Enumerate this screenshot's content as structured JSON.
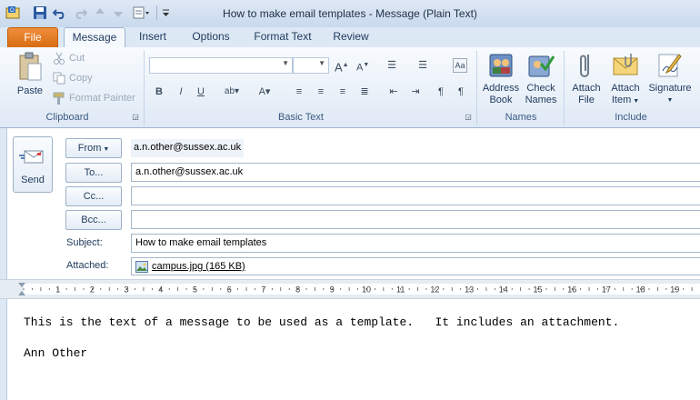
{
  "window": {
    "title": "How to make email templates  -  Message (Plain Text)"
  },
  "tabs": [
    {
      "label": "File"
    },
    {
      "label": "Message"
    },
    {
      "label": "Insert"
    },
    {
      "label": "Options"
    },
    {
      "label": "Format Text"
    },
    {
      "label": "Review"
    }
  ],
  "ribbon": {
    "clipboard": {
      "label": "Clipboard",
      "paste": "Paste",
      "cut": "Cut",
      "copy": "Copy",
      "format_painter": "Format Painter"
    },
    "basic_text": {
      "label": "Basic Text"
    },
    "names": {
      "label": "Names",
      "address_book_1": "Address",
      "address_book_2": "Book",
      "check_names_1": "Check",
      "check_names_2": "Names"
    },
    "include": {
      "label": "Include",
      "attach_file_1": "Attach",
      "attach_file_2": "File",
      "attach_item_1": "Attach",
      "attach_item_2": "Item",
      "signature": "Signature"
    }
  },
  "compose": {
    "send": "Send",
    "from_label": "From",
    "from_value": "a.n.other@sussex.ac.uk",
    "to_label": "To...",
    "to_value": "a.n.other@sussex.ac.uk",
    "cc_label": "Cc...",
    "cc_value": "",
    "bcc_label": "Bcc...",
    "bcc_value": "",
    "subject_label": "Subject:",
    "subject_value": "How to make email templates",
    "attached_label": "Attached:",
    "attachment": "campus.jpg (165 KB)"
  },
  "ruler_numbers": [
    "1",
    "2",
    "3",
    "4",
    "5",
    "6",
    "7",
    "8",
    "9",
    "10",
    "11",
    "12",
    "13",
    "14",
    "15",
    "16",
    "17",
    "18",
    "19"
  ],
  "body": {
    "line1": "This is the text of a message to be used as a template.   It includes an attachment.",
    "line2": "Ann Other"
  },
  "colors": {
    "file_tab": "#e1741c",
    "ribbon_bg": "#dfe9f5",
    "text": "#1e395b"
  }
}
